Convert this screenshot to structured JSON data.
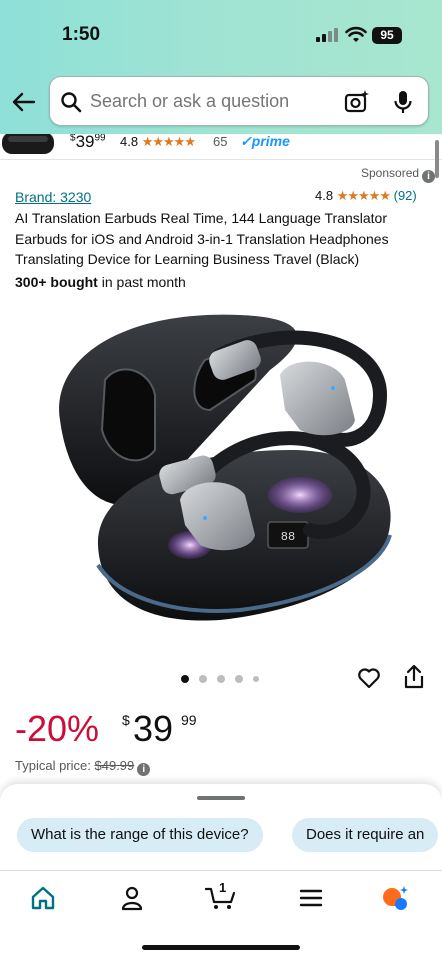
{
  "status_bar": {
    "time": "1:50",
    "battery": "95"
  },
  "search": {
    "placeholder": "Search or ask a question"
  },
  "sticky_bar": {
    "price_currency": "$",
    "price_whole": "39",
    "price_fraction": "99",
    "rating": "4.8",
    "stars": "★★★★★",
    "review_count": "65",
    "prime_label": "✓prime"
  },
  "sponsored_label": "Sponsored",
  "product": {
    "brand": "Brand: 3230",
    "rating": "4.8",
    "stars": "★★★★★",
    "review_count": "(92)",
    "title": "AI Translation Earbuds Real Time, 144 Language Translator Earbuds for iOS and Android 3-in-1 Translation Headphones Translating Device for Learning Business Travel (Black)",
    "bought_bold": "300+ bought",
    "bought_rest": " in past month",
    "image_count": 5,
    "active_image": 0,
    "discount": "-20%",
    "price_currency": "$",
    "price_whole": "39",
    "price_fraction": "99",
    "typical_label": "Typical price:",
    "typical_price": "$49.99"
  },
  "suggestions": [
    "What is the range of this device?",
    "Does it require an"
  ],
  "nav": {
    "items": [
      "home-icon",
      "account-icon",
      "cart-icon",
      "menu-icon",
      "rufus-icon"
    ],
    "cart_count": "1"
  },
  "colors": {
    "header_gradient_start": "#8ee0d8",
    "header_gradient_end": "#a8e6cf",
    "discount": "#cc0c39",
    "link": "#007185",
    "star": "#de7921",
    "prime": "#1a98ff",
    "chip_bg": "#d8ecf6"
  }
}
